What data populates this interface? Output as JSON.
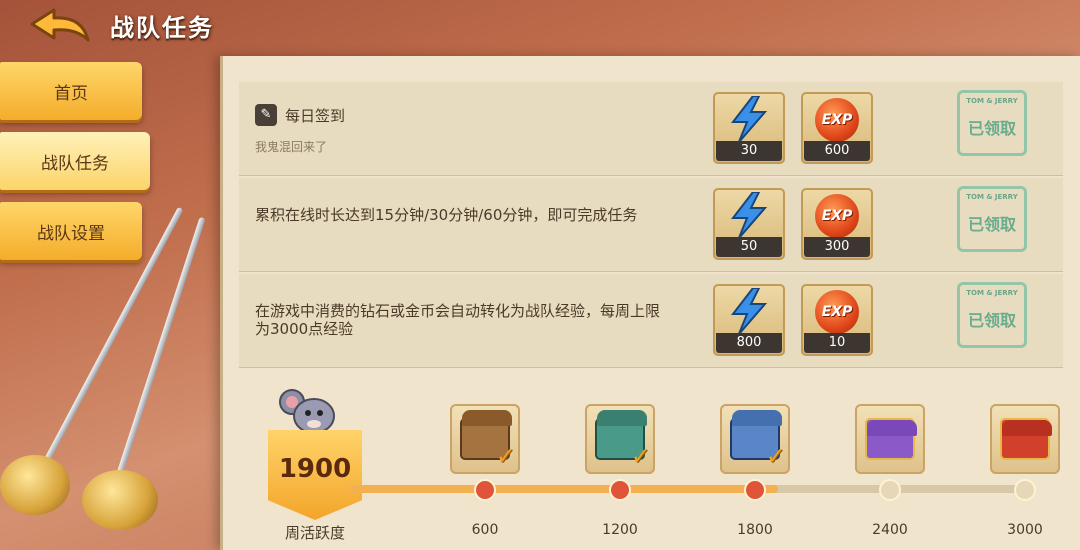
{
  "header": {
    "title": "战队任务"
  },
  "sidebar": {
    "items": [
      {
        "label": "首页",
        "active": false
      },
      {
        "label": "战队任务",
        "active": true
      },
      {
        "label": "战队设置",
        "active": false
      }
    ]
  },
  "tasks": [
    {
      "title": "每日签到",
      "subtitle": "我鬼混回来了",
      "rewards": [
        {
          "type": "lightning",
          "count": "30"
        },
        {
          "type": "exp",
          "label": "EXP",
          "count": "600"
        }
      ],
      "status": {
        "brand": "TOM & JERRY",
        "text": "已领取"
      }
    },
    {
      "title": "累积在线时长达到15分钟/30分钟/60分钟，即可完成任务",
      "subtitle": "",
      "rewards": [
        {
          "type": "lightning",
          "count": "50"
        },
        {
          "type": "exp",
          "label": "EXP",
          "count": "300"
        }
      ],
      "status": {
        "brand": "TOM & JERRY",
        "text": "已领取"
      }
    },
    {
      "title": "在游戏中消费的钻石或金币会自动转化为战队经验，每周上限为3000点经验",
      "subtitle": "",
      "rewards": [
        {
          "type": "lightning",
          "count": "800"
        },
        {
          "type": "exp",
          "label": "EXP",
          "count": "10"
        }
      ],
      "status": {
        "brand": "TOM & JERRY",
        "text": "已领取"
      }
    }
  ],
  "weekly": {
    "label": "周活跃度",
    "score": "1900",
    "progress_fraction": 0.63,
    "milestones": [
      {
        "value": "600",
        "reached": true,
        "claimed": true,
        "chest": "wood"
      },
      {
        "value": "1200",
        "reached": true,
        "claimed": true,
        "chest": "green"
      },
      {
        "value": "1800",
        "reached": true,
        "claimed": true,
        "chest": "blue"
      },
      {
        "value": "2400",
        "reached": false,
        "claimed": false,
        "chest": "purple"
      },
      {
        "value": "3000",
        "reached": false,
        "claimed": false,
        "chest": "red"
      }
    ]
  },
  "colors": {
    "accent": "#f4ad2a",
    "node_done": "#e0543a",
    "stamp": "#5aa587"
  }
}
